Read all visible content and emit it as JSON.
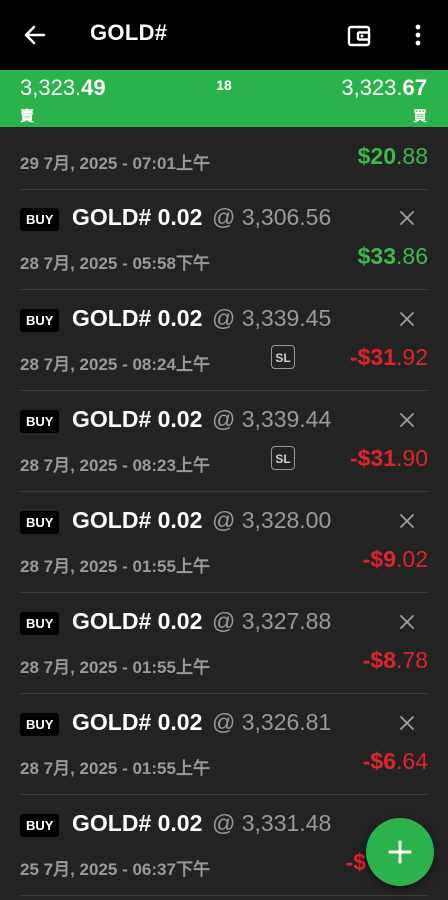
{
  "header": {
    "title": "GOLD#",
    "icons": {
      "back": "arrow-left-icon",
      "wallet": "wallet-icon",
      "more": "more-vertical-icon"
    }
  },
  "quote": {
    "bid_main": "3,323.",
    "bid_bold": "49",
    "spread": "18",
    "ask_main": "3,323.",
    "ask_bold": "67",
    "bid_label": "賣",
    "ask_label": "買"
  },
  "positions": [
    {
      "date": "29 7月, 2025 - 07:01上午",
      "pl_main": "$20",
      "pl_cents": ".88",
      "pl_sign": "positive",
      "partial": true
    },
    {
      "type": "BUY",
      "symbol": "GOLD# 0.02",
      "price": "@ 3,306.56",
      "date": "28 7月, 2025 - 05:58下午",
      "sl": "",
      "pl_main": "$33",
      "pl_cents": ".86",
      "pl_sign": "positive"
    },
    {
      "type": "BUY",
      "symbol": "GOLD# 0.02",
      "price": "@ 3,339.45",
      "date": "28 7月, 2025 - 08:24上午",
      "sl": "SL",
      "pl_main": "-$31",
      "pl_cents": ".92",
      "pl_sign": "negative"
    },
    {
      "type": "BUY",
      "symbol": "GOLD# 0.02",
      "price": "@ 3,339.44",
      "date": "28 7月, 2025 - 08:23上午",
      "sl": "SL",
      "pl_main": "-$31",
      "pl_cents": ".90",
      "pl_sign": "negative"
    },
    {
      "type": "BUY",
      "symbol": "GOLD# 0.02",
      "price": "@ 3,328.00",
      "date": "28 7月, 2025 - 01:55上午",
      "sl": "",
      "pl_main": "-$9",
      "pl_cents": ".02",
      "pl_sign": "negative"
    },
    {
      "type": "BUY",
      "symbol": "GOLD# 0.02",
      "price": "@ 3,327.88",
      "date": "28 7月, 2025 - 01:55上午",
      "sl": "",
      "pl_main": "-$8",
      "pl_cents": ".78",
      "pl_sign": "negative"
    },
    {
      "type": "BUY",
      "symbol": "GOLD# 0.02",
      "price": "@ 3,326.81",
      "date": "28 7月, 2025 - 01:55上午",
      "sl": "",
      "pl_main": "-$6",
      "pl_cents": ".64",
      "pl_sign": "negative"
    },
    {
      "type": "BUY",
      "symbol": "GOLD# 0.02",
      "price": "@ 3,331.48",
      "date": "25 7月, 2025 - 06:37下午",
      "sl": "",
      "pl_main": "-$",
      "pl_cents": "",
      "pl_sign": "negative"
    }
  ],
  "fab": {
    "icon": "plus-icon"
  },
  "colors": {
    "accent": "#29b34a",
    "profit": "#3dba4e",
    "loss": "#e0242c",
    "background": "#232323",
    "topbar": "#000000"
  }
}
